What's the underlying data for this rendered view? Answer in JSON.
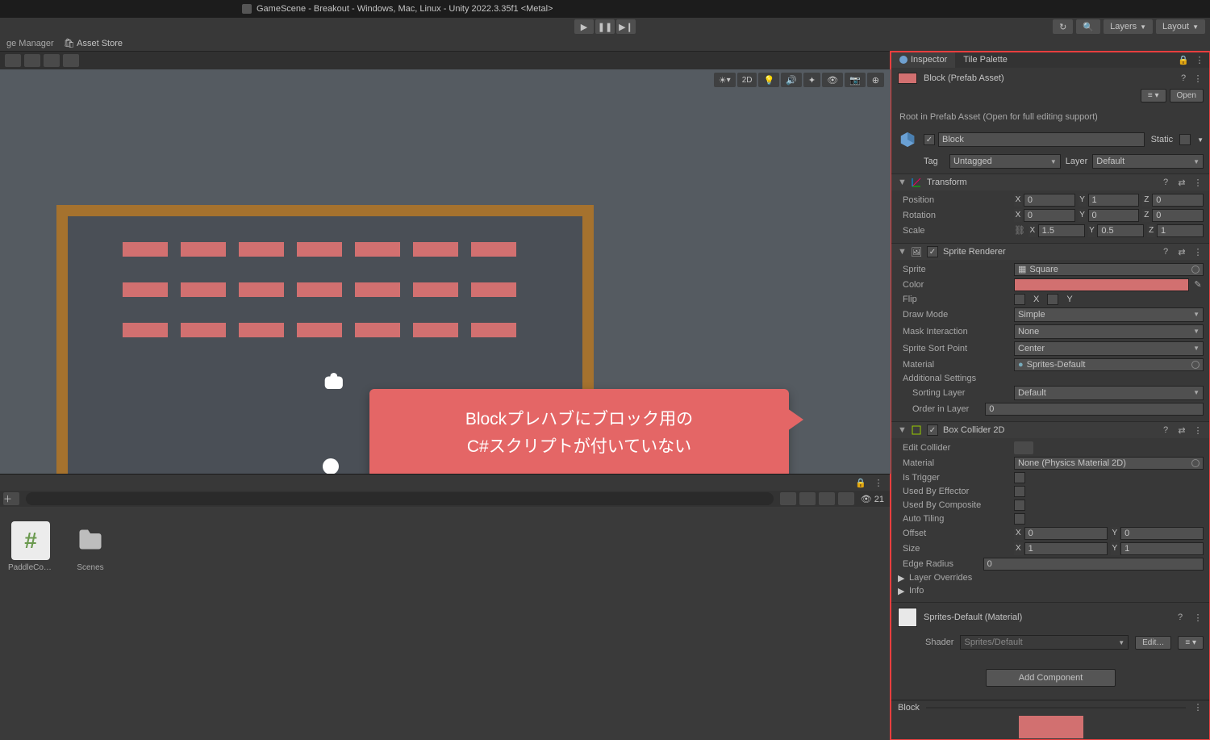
{
  "window_title": "GameScene - Breakout - Windows, Mac, Linux - Unity 2022.3.35f1 <Metal>",
  "top_right": {
    "layers": "Layers",
    "layout": "Layout"
  },
  "subtabs": {
    "package_manager": "ge Manager",
    "asset_store": "Asset Store"
  },
  "scene_toolbar": {
    "btn_2d": "2D"
  },
  "callout": {
    "line1": "Blockプレハブにブロック用の",
    "line2": "C#スクリプトが付いていない"
  },
  "project": {
    "search_placeholder": "",
    "count_label": "21",
    "assets": [
      {
        "name": "PaddleCon…",
        "kind": "script"
      },
      {
        "name": "Scenes",
        "kind": "folder"
      }
    ]
  },
  "inspector": {
    "tabs": {
      "inspector": "Inspector",
      "tile_palette": "Tile Palette"
    },
    "prefab_label": "Block (Prefab Asset)",
    "open_btn": "Open",
    "root_msg": "Root in Prefab Asset (Open for full editing support)",
    "object": {
      "name": "Block",
      "static_label": "Static",
      "tag_label": "Tag",
      "tag_value": "Untagged",
      "layer_label": "Layer",
      "layer_value": "Default"
    },
    "transform": {
      "title": "Transform",
      "position_label": "Position",
      "pos": {
        "x": "0",
        "y": "1",
        "z": "0"
      },
      "rotation_label": "Rotation",
      "rot": {
        "x": "0",
        "y": "0",
        "z": "0"
      },
      "scale_label": "Scale",
      "scale": {
        "x": "1.5",
        "y": "0.5",
        "z": "1"
      }
    },
    "sprite_renderer": {
      "title": "Sprite Renderer",
      "sprite_label": "Sprite",
      "sprite_value": "Square",
      "color_label": "Color",
      "flip_label": "Flip",
      "flip_x": "X",
      "flip_y": "Y",
      "drawmode_label": "Draw Mode",
      "drawmode_value": "Simple",
      "mask_label": "Mask Interaction",
      "mask_value": "None",
      "sortpoint_label": "Sprite Sort Point",
      "sortpoint_value": "Center",
      "material_label": "Material",
      "material_value": "Sprites-Default",
      "additional_label": "Additional Settings",
      "sortlayer_label": "Sorting Layer",
      "sortlayer_value": "Default",
      "order_label": "Order in Layer",
      "order_value": "0"
    },
    "box_collider": {
      "title": "Box Collider 2D",
      "edit_label": "Edit Collider",
      "material_label": "Material",
      "material_value": "None (Physics Material 2D)",
      "trigger_label": "Is Trigger",
      "effector_label": "Used By Effector",
      "composite_label": "Used By Composite",
      "autotile_label": "Auto Tiling",
      "offset_label": "Offset",
      "offset": {
        "x": "0",
        "y": "0"
      },
      "size_label": "Size",
      "size": {
        "x": "1",
        "y": "1"
      },
      "radius_label": "Edge Radius",
      "radius_value": "0",
      "overrides_label": "Layer Overrides",
      "info_label": "Info"
    },
    "material_section": {
      "title": "Sprites-Default (Material)",
      "shader_label": "Shader",
      "shader_value": "Sprites/Default",
      "edit_label": "Edit…"
    },
    "add_component": "Add Component",
    "footer_label": "Block"
  }
}
